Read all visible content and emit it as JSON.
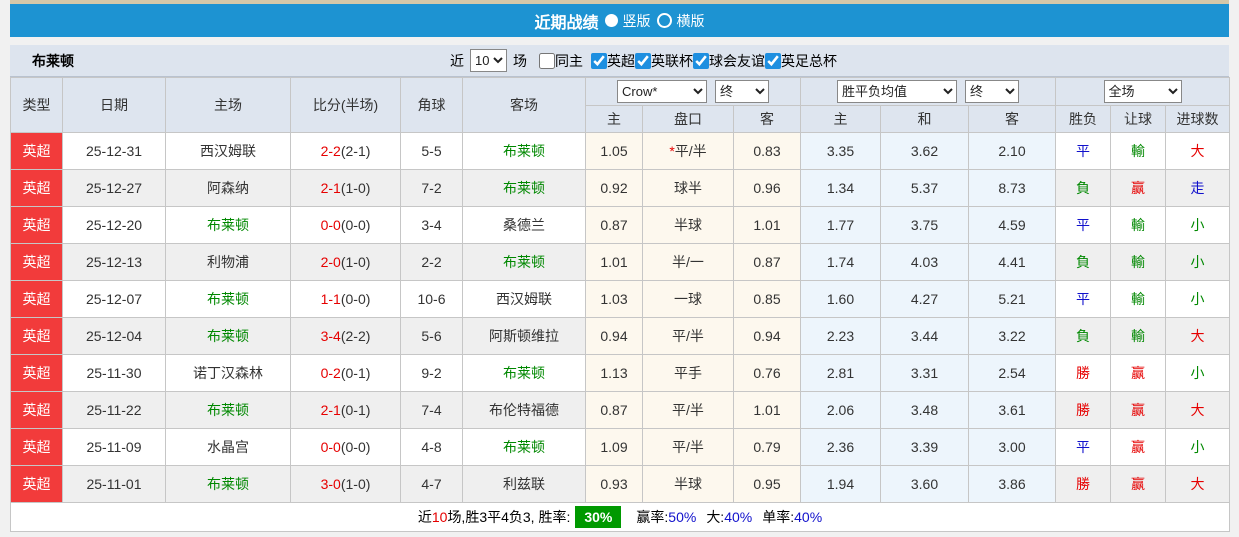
{
  "colors": {
    "accent_blue": "#1d93d2",
    "badge_red": "#f23b3b",
    "win_red": "#e60000",
    "lose_green": "#008800",
    "draw_blue": "#1111cc",
    "rate_box_green": "#009900",
    "odds_col_bg": "#fdf8ee",
    "mean_col_bg": "#edf5fc"
  },
  "header": {
    "title": "近期战绩",
    "vertical_label": "竖版",
    "horizontal_label": "横版",
    "selected_layout": "竖版"
  },
  "toolbar": {
    "team": "布莱顿",
    "near_label": "近",
    "games_value": "10",
    "games_suffix": "场",
    "same_home": {
      "label": "同主",
      "checked": false
    },
    "competitions": [
      {
        "label": "英超",
        "checked": true
      },
      {
        "label": "英联杯",
        "checked": true
      },
      {
        "label": "球会友谊",
        "checked": true
      },
      {
        "label": "英足总杯",
        "checked": true
      }
    ]
  },
  "table": {
    "columns": [
      "类型",
      "日期",
      "主场",
      "比分(半场)",
      "角球",
      "客场"
    ],
    "subcolumns": [
      "主",
      "盘口",
      "客",
      "主",
      "和",
      "客",
      "胜负",
      "让球",
      "进球数"
    ],
    "selects": {
      "odds_company": "Crow*",
      "odds_state": "终",
      "mean": "胜平负均值",
      "mean_state": "终",
      "scope": "全场"
    },
    "rows": [
      {
        "league": "英超",
        "date": "25-12-31",
        "home": "西汉姆联",
        "score_ft": "2-2",
        "score_ht": "(2-1)",
        "corners": "5-5",
        "away": "布莱顿",
        "odds_home": "1.05",
        "handicap": "平/半",
        "handicap_star": true,
        "odds_away": "0.83",
        "mean_home": "3.35",
        "mean_draw": "3.62",
        "mean_away": "2.10",
        "result": "平",
        "handicap_result": "輸",
        "goals_result": "大"
      },
      {
        "league": "英超",
        "date": "25-12-27",
        "home": "阿森纳",
        "score_ft": "2-1",
        "score_ht": "(1-0)",
        "corners": "7-2",
        "away": "布莱顿",
        "odds_home": "0.92",
        "handicap": "球半",
        "handicap_star": false,
        "odds_away": "0.96",
        "mean_home": "1.34",
        "mean_draw": "5.37",
        "mean_away": "8.73",
        "result": "負",
        "handicap_result": "赢",
        "goals_result": "走"
      },
      {
        "league": "英超",
        "date": "25-12-20",
        "home": "布莱顿",
        "score_ft": "0-0",
        "score_ht": "(0-0)",
        "corners": "3-4",
        "away": "桑德兰",
        "odds_home": "0.87",
        "handicap": "半球",
        "handicap_star": false,
        "odds_away": "1.01",
        "mean_home": "1.77",
        "mean_draw": "3.75",
        "mean_away": "4.59",
        "result": "平",
        "handicap_result": "輸",
        "goals_result": "小"
      },
      {
        "league": "英超",
        "date": "25-12-13",
        "home": "利物浦",
        "score_ft": "2-0",
        "score_ht": "(1-0)",
        "corners": "2-2",
        "away": "布莱顿",
        "odds_home": "1.01",
        "handicap": "半/一",
        "handicap_star": false,
        "odds_away": "0.87",
        "mean_home": "1.74",
        "mean_draw": "4.03",
        "mean_away": "4.41",
        "result": "負",
        "handicap_result": "輸",
        "goals_result": "小"
      },
      {
        "league": "英超",
        "date": "25-12-07",
        "home": "布莱顿",
        "score_ft": "1-1",
        "score_ht": "(0-0)",
        "corners": "10-6",
        "away": "西汉姆联",
        "odds_home": "1.03",
        "handicap": "一球",
        "handicap_star": false,
        "odds_away": "0.85",
        "mean_home": "1.60",
        "mean_draw": "4.27",
        "mean_away": "5.21",
        "result": "平",
        "handicap_result": "輸",
        "goals_result": "小"
      },
      {
        "league": "英超",
        "date": "25-12-04",
        "home": "布莱顿",
        "score_ft": "3-4",
        "score_ht": "(2-2)",
        "corners": "5-6",
        "away": "阿斯顿维拉",
        "odds_home": "0.94",
        "handicap": "平/半",
        "handicap_star": false,
        "odds_away": "0.94",
        "mean_home": "2.23",
        "mean_draw": "3.44",
        "mean_away": "3.22",
        "result": "負",
        "handicap_result": "輸",
        "goals_result": "大"
      },
      {
        "league": "英超",
        "date": "25-11-30",
        "home": "诺丁汉森林",
        "score_ft": "0-2",
        "score_ht": "(0-1)",
        "corners": "9-2",
        "away": "布莱顿",
        "odds_home": "1.13",
        "handicap": "平手",
        "handicap_star": false,
        "odds_away": "0.76",
        "mean_home": "2.81",
        "mean_draw": "3.31",
        "mean_away": "2.54",
        "result": "勝",
        "handicap_result": "赢",
        "goals_result": "小"
      },
      {
        "league": "英超",
        "date": "25-11-22",
        "home": "布莱顿",
        "score_ft": "2-1",
        "score_ht": "(0-1)",
        "corners": "7-4",
        "away": "布伦特福德",
        "odds_home": "0.87",
        "handicap": "平/半",
        "handicap_star": false,
        "odds_away": "1.01",
        "mean_home": "2.06",
        "mean_draw": "3.48",
        "mean_away": "3.61",
        "result": "勝",
        "handicap_result": "赢",
        "goals_result": "大"
      },
      {
        "league": "英超",
        "date": "25-11-09",
        "home": "水晶宫",
        "score_ft": "0-0",
        "score_ht": "(0-0)",
        "corners": "4-8",
        "away": "布莱顿",
        "odds_home": "1.09",
        "handicap": "平/半",
        "handicap_star": false,
        "odds_away": "0.79",
        "mean_home": "2.36",
        "mean_draw": "3.39",
        "mean_away": "3.00",
        "result": "平",
        "handicap_result": "赢",
        "goals_result": "小"
      },
      {
        "league": "英超",
        "date": "25-11-01",
        "home": "布莱顿",
        "score_ft": "3-0",
        "score_ht": "(1-0)",
        "corners": "4-7",
        "away": "利兹联",
        "odds_home": "0.93",
        "handicap": "半球",
        "handicap_star": false,
        "odds_away": "0.95",
        "mean_home": "1.94",
        "mean_draw": "3.60",
        "mean_away": "3.86",
        "result": "勝",
        "handicap_result": "赢",
        "goals_result": "大"
      }
    ]
  },
  "summary": {
    "near": "近",
    "count": "10",
    "record": "场,胜3平4负3, 胜率:",
    "win_rate": "30%",
    "win_label": "赢率:",
    "win_value": "50%",
    "big_label": "大:",
    "big_value": "40%",
    "single_label": "单率:",
    "single_value": "40%"
  }
}
